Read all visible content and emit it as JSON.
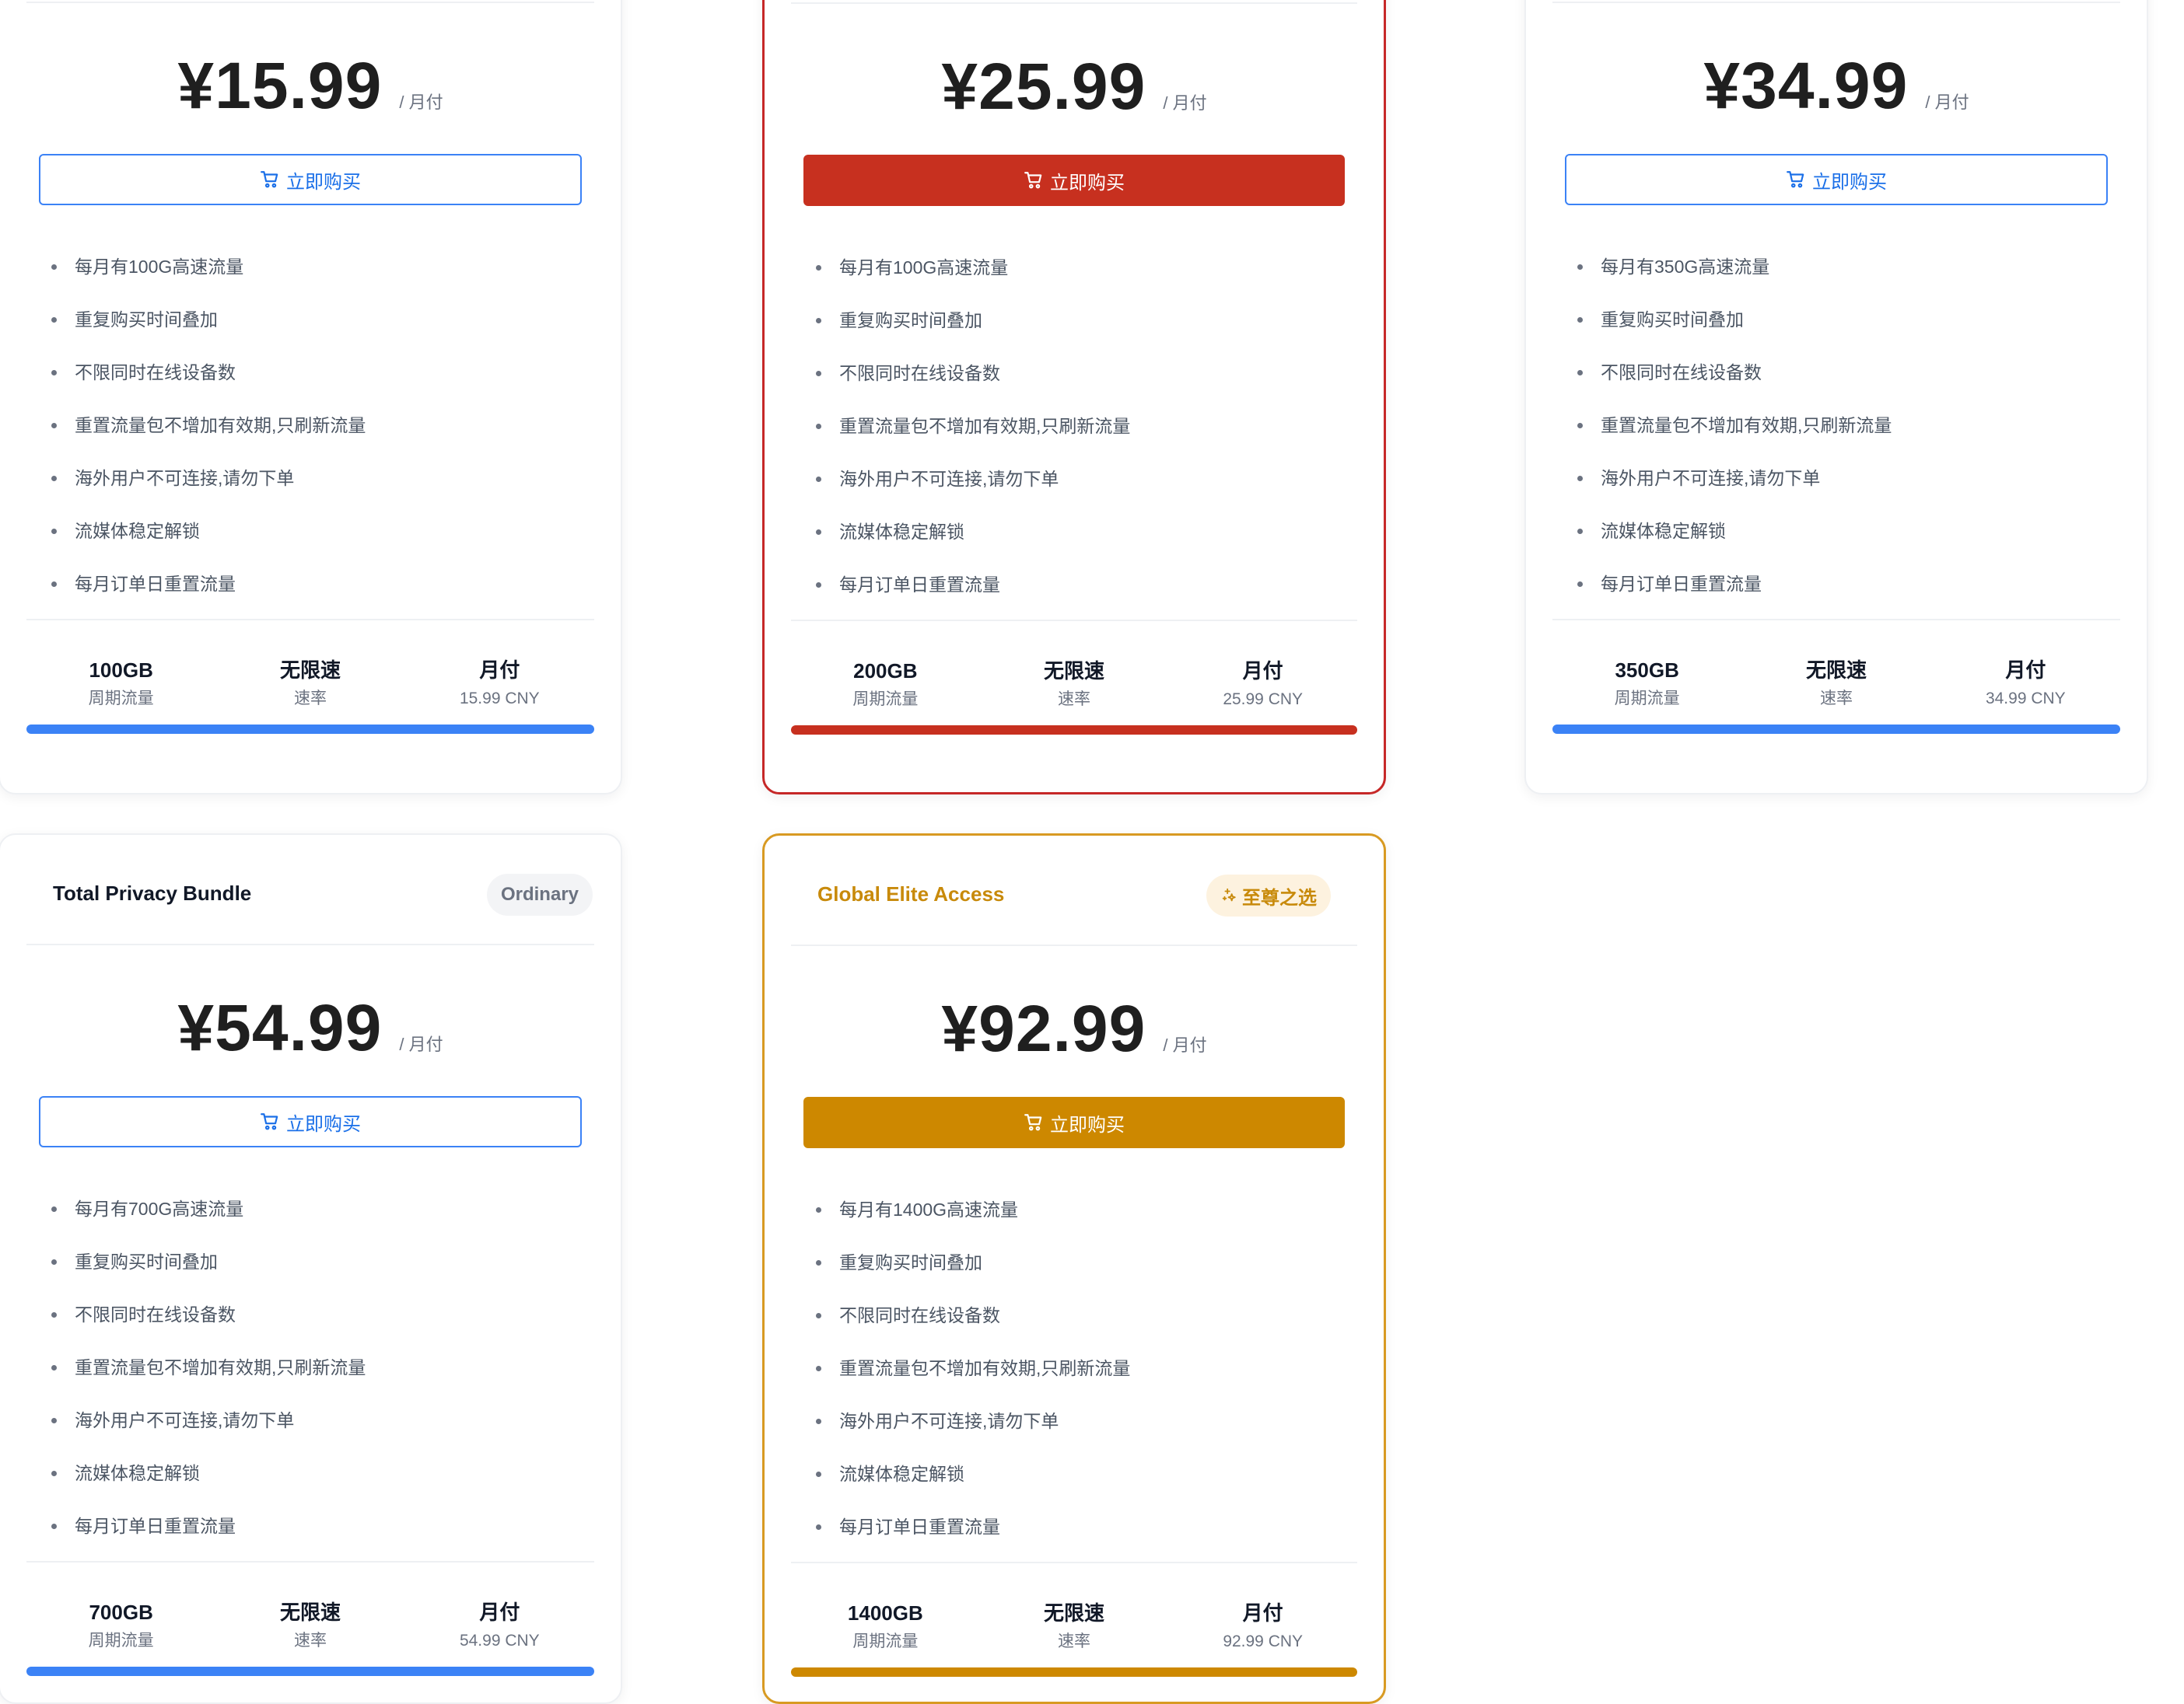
{
  "colors": {
    "blue_bar": "#3b82f6",
    "red_accent": "#c7301f",
    "gold_accent": "#cd8800",
    "outline_button": "#3b82f6"
  },
  "common": {
    "buy_label": "立即购买",
    "period": "/ 月付",
    "speed_value": "无限速",
    "speed_label": "速率",
    "traffic_label": "周期流量",
    "billing_value": "月付"
  },
  "plans": [
    {
      "price": "¥15.99",
      "traffic": "100GB",
      "billing_amount": "15.99 CNY",
      "features": [
        "每月有100G高速流量",
        "重复购买时间叠加",
        "不限同时在线设备数",
        "重置流量包不增加有效期,只刷新流量",
        "海外用户不可连接,请勿下单",
        "流媒体稳定解锁",
        "每月订单日重置流量"
      ]
    },
    {
      "price": "¥25.99",
      "traffic": "200GB",
      "billing_amount": "25.99 CNY",
      "features": [
        "每月有100G高速流量",
        "重复购买时间叠加",
        "不限同时在线设备数",
        "重置流量包不增加有效期,只刷新流量",
        "海外用户不可连接,请勿下单",
        "流媒体稳定解锁",
        "每月订单日重置流量"
      ]
    },
    {
      "price": "¥34.99",
      "traffic": "350GB",
      "billing_amount": "34.99 CNY",
      "features": [
        "每月有350G高速流量",
        "重复购买时间叠加",
        "不限同时在线设备数",
        "重置流量包不增加有效期,只刷新流量",
        "海外用户不可连接,请勿下单",
        "流媒体稳定解锁",
        "每月订单日重置流量"
      ]
    },
    {
      "name": "Total Privacy Bundle",
      "tag": "Ordinary",
      "price": "¥54.99",
      "traffic": "700GB",
      "billing_amount": "54.99 CNY",
      "features": [
        "每月有700G高速流量",
        "重复购买时间叠加",
        "不限同时在线设备数",
        "重置流量包不增加有效期,只刷新流量",
        "海外用户不可连接,请勿下单",
        "流媒体稳定解锁",
        "每月订单日重置流量"
      ]
    },
    {
      "name": "Global Elite Access",
      "tag": "至尊之选",
      "tag_icon": "sparkle-icon",
      "price": "¥92.99",
      "traffic": "1400GB",
      "billing_amount": "92.99 CNY",
      "features": [
        "每月有1400G高速流量",
        "重复购买时间叠加",
        "不限同时在线设备数",
        "重置流量包不增加有效期,只刷新流量",
        "海外用户不可连接,请勿下单",
        "流媒体稳定解锁",
        "每月订单日重置流量"
      ]
    }
  ]
}
